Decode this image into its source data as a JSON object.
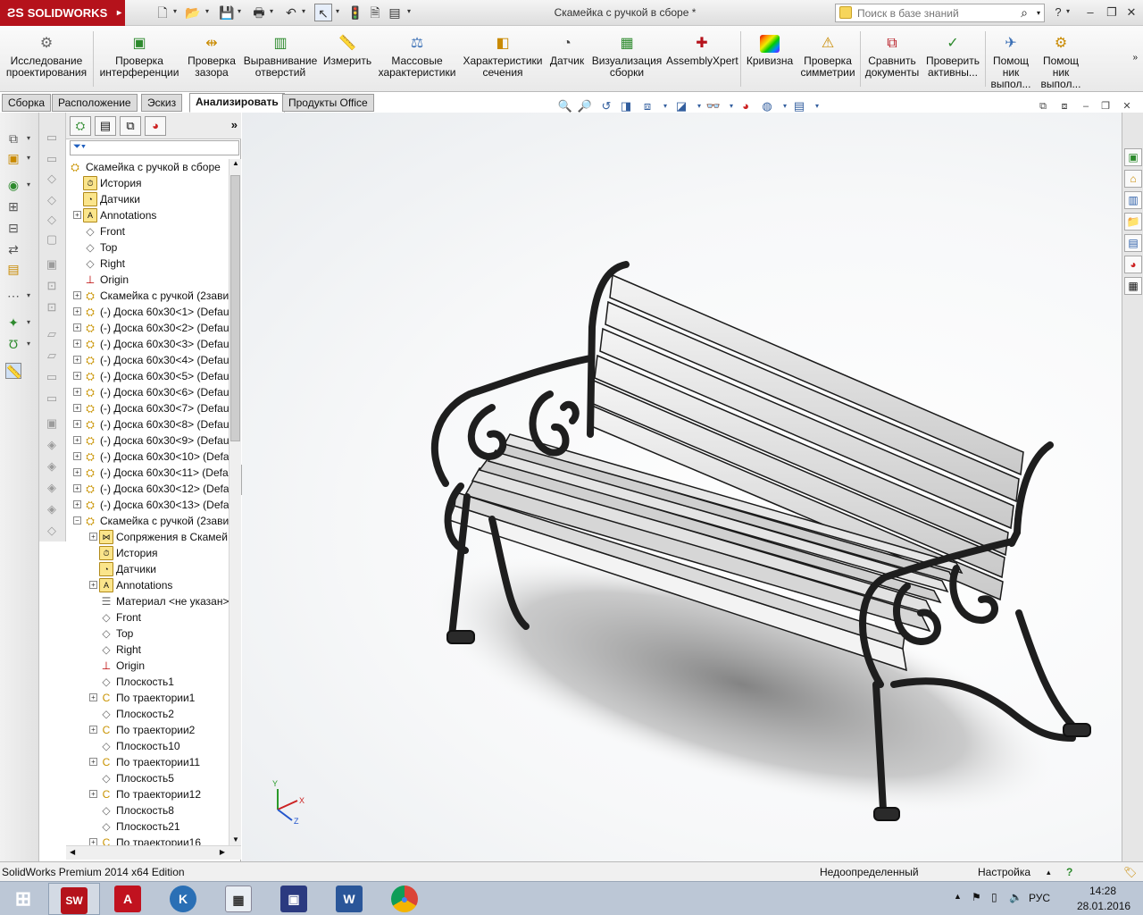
{
  "app": {
    "brand": "SOLIDWORKS",
    "doc_title": "Скамейка с ручкой в сборе *"
  },
  "search": {
    "placeholder": "Поиск в базе знаний"
  },
  "ribbon": {
    "buttons": [
      {
        "label": "Исследование\nпроектирования",
        "icon": "design-study-icon"
      },
      {
        "label": "Проверка\nинтерференции",
        "icon": "interference-check-icon"
      },
      {
        "label": "Проверка\nзазора",
        "icon": "clearance-check-icon"
      },
      {
        "label": "Выравнивание\nотверстий",
        "icon": "hole-alignment-icon"
      },
      {
        "label": "Измерить",
        "icon": "measure-icon"
      },
      {
        "label": "Массовые\nхарактеристики",
        "icon": "mass-properties-icon"
      },
      {
        "label": "Характеристики\nсечения",
        "icon": "section-properties-icon"
      },
      {
        "label": "Датчик",
        "icon": "sensor-icon"
      },
      {
        "label": "Визуализация\nсборки",
        "icon": "assembly-visualization-icon"
      },
      {
        "label": "AssemblyXpert",
        "icon": "assemblyxpert-icon"
      },
      {
        "label": "Кривизна",
        "icon": "curvature-icon"
      },
      {
        "label": "Проверка\nсимметрии",
        "icon": "symmetry-check-icon"
      },
      {
        "label": "Сравнить\nдокументы",
        "icon": "compare-documents-icon"
      },
      {
        "label": "Проверить\nактивны...",
        "icon": "check-active-icon"
      },
      {
        "label": "Помощ\nник\nвыпол...",
        "icon": "assistant-icon"
      },
      {
        "label": "Помощ\nник\nвыпол...",
        "icon": "assistant2-icon"
      }
    ]
  },
  "tabs": [
    "Сборка",
    "Расположение",
    "Эскиз",
    "Анализировать",
    "Продукты Office"
  ],
  "active_tab": "Анализировать",
  "tree": {
    "root": "Скамейка с ручкой в сборе",
    "items": [
      {
        "label": "История",
        "icon": "history-icon",
        "depth": 1,
        "exp": ""
      },
      {
        "label": "Датчики",
        "icon": "sensors-icon",
        "depth": 1,
        "exp": ""
      },
      {
        "label": "Annotations",
        "icon": "annotations-icon",
        "depth": 1,
        "exp": "+"
      },
      {
        "label": "Front",
        "icon": "plane-icon",
        "depth": 1,
        "exp": ""
      },
      {
        "label": "Top",
        "icon": "plane-icon",
        "depth": 1,
        "exp": ""
      },
      {
        "label": "Right",
        "icon": "plane-icon",
        "depth": 1,
        "exp": ""
      },
      {
        "label": "Origin",
        "icon": "origin-icon",
        "depth": 1,
        "exp": ""
      },
      {
        "label": "Скамейка с ручкой (2зави",
        "icon": "subassembly-icon",
        "depth": 1,
        "exp": "+"
      },
      {
        "label": "(-) Доска 60x30<1> (Defau",
        "icon": "part-icon",
        "depth": 1,
        "exp": "+"
      },
      {
        "label": "(-) Доска 60x30<2> (Defau",
        "icon": "part-icon",
        "depth": 1,
        "exp": "+"
      },
      {
        "label": "(-) Доска 60x30<3> (Defau",
        "icon": "part-icon",
        "depth": 1,
        "exp": "+"
      },
      {
        "label": "(-) Доска 60x30<4> (Defau",
        "icon": "part-icon",
        "depth": 1,
        "exp": "+"
      },
      {
        "label": "(-) Доска 60x30<5> (Defau",
        "icon": "part-icon",
        "depth": 1,
        "exp": "+"
      },
      {
        "label": "(-) Доска 60x30<6> (Defau",
        "icon": "part-icon",
        "depth": 1,
        "exp": "+"
      },
      {
        "label": "(-) Доска 60x30<7> (Defau",
        "icon": "part-icon",
        "depth": 1,
        "exp": "+"
      },
      {
        "label": "(-) Доска 60x30<8> (Defau",
        "icon": "part-icon",
        "depth": 1,
        "exp": "+"
      },
      {
        "label": "(-) Доска 60x30<9> (Defau",
        "icon": "part-icon",
        "depth": 1,
        "exp": "+"
      },
      {
        "label": "(-) Доска 60x30<10> (Defa",
        "icon": "part-icon",
        "depth": 1,
        "exp": "+"
      },
      {
        "label": "(-) Доска 60x30<11> (Defa",
        "icon": "part-icon",
        "depth": 1,
        "exp": "+"
      },
      {
        "label": "(-) Доска 60x30<12> (Defa",
        "icon": "part-icon",
        "depth": 1,
        "exp": "+"
      },
      {
        "label": "(-) Доска 60x30<13> (Defa",
        "icon": "part-icon",
        "depth": 1,
        "exp": "+"
      },
      {
        "label": "Скамейка с ручкой (2зави",
        "icon": "subassembly-icon",
        "depth": 1,
        "exp": "−"
      },
      {
        "label": "Сопряжения в Скамей",
        "icon": "mates-icon",
        "depth": 2,
        "exp": "+"
      },
      {
        "label": "История",
        "icon": "history-icon",
        "depth": 2,
        "exp": ""
      },
      {
        "label": "Датчики",
        "icon": "sensors-icon",
        "depth": 2,
        "exp": ""
      },
      {
        "label": "Annotations",
        "icon": "annotations-icon",
        "depth": 2,
        "exp": "+"
      },
      {
        "label": "Материал <не указан>",
        "icon": "material-icon",
        "depth": 2,
        "exp": ""
      },
      {
        "label": "Front",
        "icon": "plane-icon",
        "depth": 2,
        "exp": ""
      },
      {
        "label": "Top",
        "icon": "plane-icon",
        "depth": 2,
        "exp": ""
      },
      {
        "label": "Right",
        "icon": "plane-icon",
        "depth": 2,
        "exp": ""
      },
      {
        "label": "Origin",
        "icon": "origin-icon",
        "depth": 2,
        "exp": ""
      },
      {
        "label": "Плоскость1",
        "icon": "plane-icon",
        "depth": 2,
        "exp": ""
      },
      {
        "label": "По траектории1",
        "icon": "sweep-icon",
        "depth": 2,
        "exp": "+"
      },
      {
        "label": "Плоскость2",
        "icon": "plane-icon",
        "depth": 2,
        "exp": ""
      },
      {
        "label": "По траектории2",
        "icon": "sweep-icon",
        "depth": 2,
        "exp": "+"
      },
      {
        "label": "Плоскость10",
        "icon": "plane-icon",
        "depth": 2,
        "exp": ""
      },
      {
        "label": "По траектории11",
        "icon": "sweep-icon",
        "depth": 2,
        "exp": "+"
      },
      {
        "label": "Плоскость5",
        "icon": "plane-icon",
        "depth": 2,
        "exp": ""
      },
      {
        "label": "По траектории12",
        "icon": "sweep-icon",
        "depth": 2,
        "exp": "+"
      },
      {
        "label": "Плоскость8",
        "icon": "plane-icon",
        "depth": 2,
        "exp": ""
      },
      {
        "label": "Плоскость21",
        "icon": "plane-icon",
        "depth": 2,
        "exp": ""
      },
      {
        "label": "По траектории16",
        "icon": "sweep-icon",
        "depth": 2,
        "exp": "+"
      }
    ]
  },
  "triad": {
    "x": "X",
    "y": "Y",
    "z": "Z"
  },
  "status": {
    "edition": "SolidWorks Premium 2014 x64 Edition",
    "state": "Недоопределенный",
    "settings": "Настройка"
  },
  "taskbar": {
    "apps": [
      "SolidWorks",
      "AutoCAD",
      "KOMPAS",
      "Calculator",
      "Save",
      "Word",
      "Chrome"
    ],
    "lang": "РУС",
    "time": "14:28",
    "date": "28.01.2016"
  },
  "colors": {
    "brand_red": "#b5121b",
    "accent_blue": "#325e9e"
  }
}
